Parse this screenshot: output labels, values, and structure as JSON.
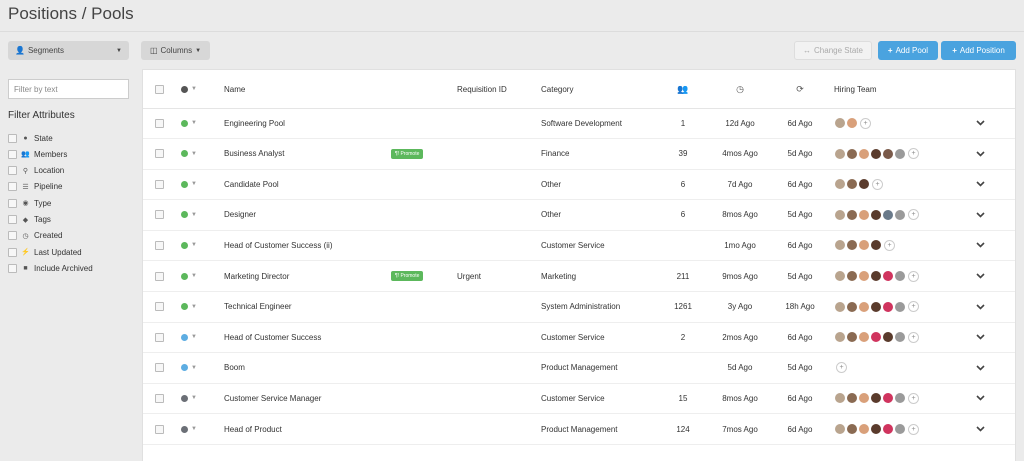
{
  "page": {
    "title": "Positions / Pools"
  },
  "toolbar": {
    "segments_label": "Segments",
    "columns_label": "Columns",
    "change_state_label": "Change State",
    "add_pool_label": "Add Pool",
    "add_position_label": "Add Position"
  },
  "filter": {
    "placeholder": "Filter by text",
    "attributes_title": "Filter Attributes",
    "attributes": [
      {
        "label": "State",
        "icon": "circle-icon"
      },
      {
        "label": "Members",
        "icon": "users-icon"
      },
      {
        "label": "Location",
        "icon": "map-pin-icon"
      },
      {
        "label": "Pipeline",
        "icon": "list-icon"
      },
      {
        "label": "Type",
        "icon": "user-circle-icon"
      },
      {
        "label": "Tags",
        "icon": "tag-icon"
      },
      {
        "label": "Created",
        "icon": "clock-icon"
      },
      {
        "label": "Last Updated",
        "icon": "bolt-icon"
      },
      {
        "label": "Include Archived",
        "icon": "archive-icon"
      }
    ]
  },
  "table": {
    "headers": {
      "name": "Name",
      "requisition": "Requisition ID",
      "category": "Category",
      "hiring_team": "Hiring Team"
    },
    "colors": {
      "green": "#5cb85c",
      "blue": "#5dade2",
      "gray": "#6b6f76"
    },
    "rows": [
      {
        "status": "green",
        "name": "Engineering Pool",
        "promote": "",
        "requisition": "",
        "category": "Software Development",
        "members": "1",
        "created": "12d Ago",
        "updated": "6d Ago",
        "avatars": [
          "#b9a48e",
          "#d9a07a"
        ]
      },
      {
        "status": "green",
        "name": "Business Analyst",
        "promote": "¶! Promote",
        "requisition": "",
        "category": "Finance",
        "members": "39",
        "created": "4mos Ago",
        "updated": "5d Ago",
        "avatars": [
          "#b9a48e",
          "#8a6a52",
          "#d9a07a",
          "#5a3b2c",
          "#7a5a4a",
          "#9a9a9a"
        ]
      },
      {
        "status": "green",
        "name": "Candidate Pool",
        "promote": "",
        "requisition": "",
        "category": "Other",
        "members": "6",
        "created": "7d Ago",
        "updated": "6d Ago",
        "avatars": [
          "#b9a48e",
          "#8a6a52",
          "#5a3b2c"
        ]
      },
      {
        "status": "green",
        "name": "Designer",
        "promote": "",
        "requisition": "",
        "category": "Other",
        "members": "6",
        "created": "8mos Ago",
        "updated": "5d Ago",
        "avatars": [
          "#b9a48e",
          "#8a6a52",
          "#d9a07a",
          "#5a3b2c",
          "#6a7a8a",
          "#9a9a9a"
        ]
      },
      {
        "status": "green",
        "name": "Head of Customer Success (ii)",
        "promote": "",
        "requisition": "",
        "category": "Customer Service",
        "members": "",
        "created": "1mo Ago",
        "updated": "6d Ago",
        "avatars": [
          "#b9a48e",
          "#8a6a52",
          "#d9a07a",
          "#5a3b2c"
        ]
      },
      {
        "status": "green",
        "name": "Marketing Director",
        "promote": "¶! Promote",
        "requisition": "Urgent",
        "category": "Marketing",
        "members": "211",
        "created": "9mos Ago",
        "updated": "5d Ago",
        "avatars": [
          "#b9a48e",
          "#8a6a52",
          "#d9a07a",
          "#5a3b2c",
          "#d0345e",
          "#9a9a9a"
        ]
      },
      {
        "status": "green",
        "name": "Technical Engineer",
        "promote": "",
        "requisition": "",
        "category": "System Administration",
        "members": "1261",
        "created": "3y Ago",
        "updated": "18h Ago",
        "avatars": [
          "#b9a48e",
          "#8a6a52",
          "#d9a07a",
          "#5a3b2c",
          "#d0345e",
          "#9a9a9a"
        ]
      },
      {
        "status": "blue",
        "name": "Head of Customer Success",
        "promote": "",
        "requisition": "",
        "category": "Customer Service",
        "members": "2",
        "created": "2mos Ago",
        "updated": "6d Ago",
        "avatars": [
          "#b9a48e",
          "#8a6a52",
          "#d9a07a",
          "#d0345e",
          "#5a3b2c",
          "#9a9a9a"
        ]
      },
      {
        "status": "blue",
        "name": "Boom",
        "promote": "",
        "requisition": "",
        "category": "Product Management",
        "members": "",
        "created": "5d Ago",
        "updated": "5d Ago",
        "avatars": []
      },
      {
        "status": "gray",
        "name": "Customer Service Manager",
        "promote": "",
        "requisition": "",
        "category": "Customer Service",
        "members": "15",
        "created": "8mos Ago",
        "updated": "6d Ago",
        "avatars": [
          "#b9a48e",
          "#8a6a52",
          "#d9a07a",
          "#5a3b2c",
          "#d0345e",
          "#9a9a9a"
        ]
      },
      {
        "status": "gray",
        "name": "Head of Product",
        "promote": "",
        "requisition": "",
        "category": "Product Management",
        "members": "124",
        "created": "7mos Ago",
        "updated": "6d Ago",
        "avatars": [
          "#b9a48e",
          "#8a6a52",
          "#d9a07a",
          "#5a3b2c",
          "#d0345e",
          "#9a9a9a"
        ]
      }
    ]
  }
}
